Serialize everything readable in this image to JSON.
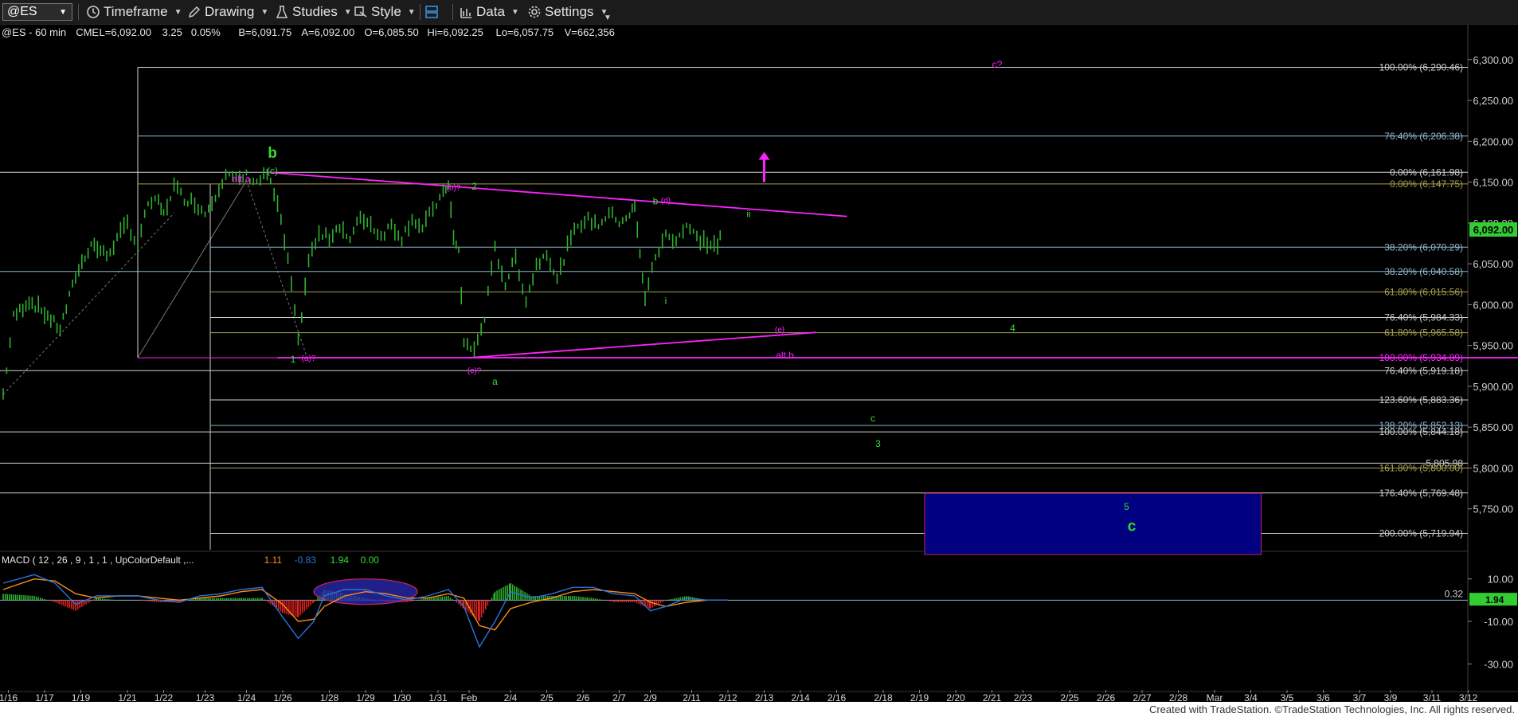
{
  "toolbar": {
    "symbol": "@ES",
    "items": [
      {
        "label": "Timeframe",
        "icon": "clock-icon"
      },
      {
        "label": "Drawing",
        "icon": "pencil-icon"
      },
      {
        "label": "Studies",
        "icon": "flask-icon"
      },
      {
        "label": "Style",
        "icon": "style-icon"
      },
      {
        "label": "Data",
        "icon": "bar-chart-icon"
      },
      {
        "label": "Settings",
        "icon": "gear-icon"
      }
    ]
  },
  "footer": {
    "credit": "Created with TradeStation. ©TradeStation Technologies, Inc. All rights reserved."
  },
  "colors": {
    "candle": "#2fb02f",
    "fib_white": "#cfcfcf",
    "fib_olive": "#a8a050",
    "fib_blue": "#8fb7cc",
    "magenta": "#ff22ff",
    "label_green": "#33dd33",
    "target_box": "#000080",
    "last_price_bg": "#33cc33",
    "macd_line": "#2a73d9",
    "signal_line": "#ff8c1a",
    "hist_up": "#2fb02f",
    "hist_down": "#e02020"
  },
  "chart_data": [
    {
      "type": "line",
      "header": {
        "symbol": "@ES - 60 min",
        "exchange": "CME",
        "last": "L=6,092.00",
        "change": "3.25",
        "change_pct": "0.05%",
        "bid": "B=6,091.75",
        "ask": "A=6,092.00",
        "open": "O=6,085.50",
        "high": "Hi=6,092.25",
        "low": "Lo=6,057.75",
        "volume": "V=662,356"
      },
      "last_price_label": "6,092.00",
      "ylim": [
        5700,
        6330
      ],
      "y_ticks": [
        "6,300.00",
        "6,250.00",
        "6,200.00",
        "6,150.00",
        "6,100.00",
        "6,050.00",
        "6,000.00",
        "5,950.00",
        "5,900.00",
        "5,850.00",
        "5,800.00",
        "5,750.00"
      ],
      "y_tick_values": [
        6300,
        6250,
        6200,
        6150,
        6100,
        6050,
        6000,
        5950,
        5900,
        5850,
        5800,
        5750
      ],
      "x_ticks": [
        "1/16",
        "1/17",
        "1/19",
        "1/21",
        "1/22",
        "1/23",
        "1/24",
        "1/26",
        "1/28",
        "1/29",
        "1/30",
        "1/31",
        "Feb",
        "2/4",
        "2/5",
        "2/6",
        "2/7",
        "2/9",
        "2/11",
        "2/12",
        "2/13",
        "2/14",
        "2/16",
        "2/18",
        "2/19",
        "2/20",
        "2/21",
        "2/23",
        "2/25",
        "2/26",
        "2/27",
        "2/28",
        "Mar",
        "3/4",
        "3/5",
        "3/6",
        "3/7",
        "3/9",
        "3/11",
        "3/12"
      ],
      "x_tick_bars": [
        1,
        8,
        15,
        24,
        31,
        39,
        47,
        54,
        63,
        70,
        77,
        84,
        90,
        98,
        105,
        112,
        119,
        125,
        133,
        140,
        147,
        154,
        161,
        170,
        177,
        184,
        191,
        197,
        206,
        213,
        220,
        227,
        234,
        241,
        248,
        255,
        262,
        268,
        276,
        283
      ],
      "price_path": [
        [
          0,
          5890
        ],
        [
          2,
          5985
        ],
        [
          5,
          6005
        ],
        [
          8,
          5990
        ],
        [
          11,
          5970
        ],
        [
          14,
          6035
        ],
        [
          17,
          6075
        ],
        [
          20,
          6060
        ],
        [
          22,
          6080
        ],
        [
          24,
          6100
        ],
        [
          26,
          6070
        ],
        [
          28,
          6125
        ],
        [
          30,
          6125
        ],
        [
          31,
          6110
        ],
        [
          33,
          6145
        ],
        [
          35,
          6130
        ],
        [
          37,
          6125
        ],
        [
          39,
          6112
        ],
        [
          41,
          6135
        ],
        [
          43,
          6160
        ],
        [
          45,
          6152
        ],
        [
          47,
          6158
        ],
        [
          49,
          6150
        ],
        [
          51,
          6160
        ],
        [
          53,
          6122
        ],
        [
          55,
          6055
        ],
        [
          57,
          5955
        ],
        [
          59,
          6055
        ],
        [
          61,
          6085
        ],
        [
          63,
          6082
        ],
        [
          65,
          6098
        ],
        [
          67,
          6078
        ],
        [
          69,
          6108
        ],
        [
          71,
          6098
        ],
        [
          73,
          6084
        ],
        [
          75,
          6098
        ],
        [
          77,
          6082
        ],
        [
          79,
          6106
        ],
        [
          81,
          6092
        ],
        [
          83,
          6118
        ],
        [
          85,
          6135
        ],
        [
          86,
          6150
        ],
        [
          87,
          6080
        ],
        [
          88,
          6065
        ],
        [
          89,
          5955
        ],
        [
          91,
          5943
        ],
        [
          93,
          5985
        ],
        [
          95,
          6068
        ],
        [
          97,
          6025
        ],
        [
          99,
          6058
        ],
        [
          101,
          6005
        ],
        [
          103,
          6048
        ],
        [
          105,
          6065
        ],
        [
          107,
          6030
        ],
        [
          109,
          6070
        ],
        [
          111,
          6098
        ],
        [
          113,
          6104
        ],
        [
          115,
          6098
        ],
        [
          117,
          6112
        ],
        [
          119,
          6102
        ],
        [
          121,
          6110
        ],
        [
          122,
          6120
        ],
        [
          123,
          6060
        ],
        [
          124,
          6010
        ],
        [
          126,
          6058
        ],
        [
          128,
          6085
        ],
        [
          130,
          6080
        ],
        [
          132,
          6097
        ],
        [
          134,
          6082
        ],
        [
          136,
          6075
        ],
        [
          138,
          6072
        ],
        [
          139,
          6092
        ]
      ],
      "fib_levels": [
        {
          "label": "100.00% (6,290.46)",
          "value": 6290.46,
          "color": "white"
        },
        {
          "label": "76.40% (6,206.38)",
          "value": 6206.38,
          "color": "blue"
        },
        {
          "label": "0.00% (6,161.98)",
          "value": 6161.98,
          "color": "white"
        },
        {
          "label": "0.00% (6,147.75)",
          "value": 6147.75,
          "color": "olive"
        },
        {
          "label": "38.20% (6,070.29)",
          "value": 6070.29,
          "color": "blue"
        },
        {
          "label": "38.20% (6,040.58)",
          "value": 6040.58,
          "color": "blue"
        },
        {
          "label": "61.80% (6,015.56)",
          "value": 6015.56,
          "color": "olive"
        },
        {
          "label": "76.40% (5,984.33)",
          "value": 5984.33,
          "color": "white"
        },
        {
          "label": "61.80% (5,965.58)",
          "value": 5965.58,
          "color": "olive"
        },
        {
          "label": "100.00% (5,934.89)",
          "value": 5934.89,
          "color": "magenta"
        },
        {
          "label": "76.40% (5,919.18)",
          "value": 5919.18,
          "color": "white"
        },
        {
          "label": "123.60% (5,883.36)",
          "value": 5883.36,
          "color": "white"
        },
        {
          "label": "138.20% (5,852.13)",
          "value": 5852.13,
          "color": "blue"
        },
        {
          "label": "100.00% (5,844.18)",
          "value": 5844.18,
          "color": "white"
        },
        {
          "label": "5,805.98",
          "value": 5805.98,
          "color": "white"
        },
        {
          "label": "161.80% (5,800.00)",
          "value": 5800.0,
          "color": "olive"
        },
        {
          "label": "176.40% (5,769.48)",
          "value": 5769.48,
          "color": "white"
        },
        {
          "label": "200.00% (5,719.94)",
          "value": 5719.94,
          "color": "white"
        }
      ],
      "trendlines": [
        {
          "from": [
            51,
            6162
          ],
          "to": [
            163,
            6108
          ],
          "color": "magenta"
        },
        {
          "from": [
            90,
            5935
          ],
          "to": [
            157,
            5966
          ],
          "color": "magenta"
        },
        {
          "from": [
            53,
            5935
          ],
          "to": [
            298,
            5935
          ],
          "color": "magenta"
        }
      ],
      "target_box": {
        "x_from": 178,
        "x_to": 243,
        "y_from": 5694,
        "y_to": 5769
      },
      "annotations": [
        {
          "text": "b",
          "x": 52,
          "y": 6180,
          "color": "green",
          "size": "large",
          "bold": true
        },
        {
          "text": "(c)",
          "x": 52,
          "y": 6160,
          "color": "green",
          "size": "small"
        },
        {
          "text": "alt a",
          "x": 46,
          "y": 6150,
          "color": "magenta",
          "size": "small"
        },
        {
          "text": "(b)?",
          "x": 87,
          "y": 6140,
          "color": "magenta",
          "size": "tiny"
        },
        {
          "text": "2",
          "x": 91,
          "y": 6141,
          "color": "green",
          "size": "small"
        },
        {
          "text": "b",
          "x": 126,
          "y": 6123,
          "color": "green",
          "size": "small"
        },
        {
          "text": "(d)",
          "x": 128,
          "y": 6124,
          "color": "magenta",
          "size": "tiny"
        },
        {
          "text": "ii",
          "x": 144,
          "y": 6107,
          "color": "green",
          "size": "small"
        },
        {
          "text": "i",
          "x": 128,
          "y": 6001,
          "color": "green",
          "size": "small"
        },
        {
          "text": "(e)",
          "x": 150,
          "y": 5966,
          "color": "magenta",
          "size": "tiny"
        },
        {
          "text": "alt b",
          "x": 151,
          "y": 5934,
          "color": "magenta",
          "size": "small"
        },
        {
          "text": "1",
          "x": 56,
          "y": 5929,
          "color": "green",
          "size": "small"
        },
        {
          "text": "(a)?",
          "x": 59,
          "y": 5931,
          "color": "magenta",
          "size": "tiny"
        },
        {
          "text": "(c)?",
          "x": 91,
          "y": 5916,
          "color": "magenta",
          "size": "tiny"
        },
        {
          "text": "a",
          "x": 95,
          "y": 5902,
          "color": "green",
          "size": "small"
        },
        {
          "text": "c?",
          "x": 192,
          "y": 6290,
          "color": "magenta",
          "size": "small"
        },
        {
          "text": "4",
          "x": 195,
          "y": 5967,
          "color": "green",
          "size": "small"
        },
        {
          "text": "c",
          "x": 168,
          "y": 5857,
          "color": "green",
          "size": "small"
        },
        {
          "text": "3",
          "x": 169,
          "y": 5826,
          "color": "green",
          "size": "small"
        },
        {
          "text": "5",
          "x": 217,
          "y": 5749,
          "color": "green",
          "size": "small"
        },
        {
          "text": "c",
          "x": 218,
          "y": 5723,
          "color": "green",
          "size": "large",
          "bold": true
        }
      ],
      "arrow_up": {
        "x": 147,
        "y_from": 6150,
        "y_to": 6185
      }
    },
    {
      "type": "line",
      "title": "MACD ( 12 , 26 , 9 , 1 , 1 , UpColorDefault ,...",
      "readouts": [
        "1.11",
        "-0.83",
        "1.94",
        "0.00"
      ],
      "ylim": [
        -40,
        20
      ],
      "y_ticks": [
        "10.00",
        "-10.00",
        "-30.00"
      ],
      "y_tick_values": [
        10,
        -10,
        -30
      ],
      "last_value_label": "1.94",
      "ref_label": "0.32",
      "macd": [
        [
          0,
          8
        ],
        [
          6,
          12
        ],
        [
          10,
          8
        ],
        [
          14,
          -2
        ],
        [
          18,
          2
        ],
        [
          22,
          2
        ],
        [
          26,
          2
        ],
        [
          30,
          0
        ],
        [
          34,
          -1
        ],
        [
          38,
          2
        ],
        [
          42,
          3
        ],
        [
          46,
          5
        ],
        [
          50,
          6
        ],
        [
          54,
          -8
        ],
        [
          57,
          -18
        ],
        [
          60,
          -10
        ],
        [
          62,
          2
        ],
        [
          66,
          5
        ],
        [
          70,
          5
        ],
        [
          74,
          2
        ],
        [
          78,
          0
        ],
        [
          82,
          2
        ],
        [
          86,
          5
        ],
        [
          89,
          -3
        ],
        [
          92,
          -22
        ],
        [
          95,
          -10
        ],
        [
          98,
          4
        ],
        [
          102,
          1
        ],
        [
          106,
          3
        ],
        [
          110,
          6
        ],
        [
          114,
          6
        ],
        [
          118,
          3
        ],
        [
          122,
          2
        ],
        [
          125,
          -5
        ],
        [
          128,
          -3
        ],
        [
          132,
          1
        ],
        [
          136,
          0
        ],
        [
          140,
          0
        ]
      ],
      "signal": [
        [
          0,
          5
        ],
        [
          6,
          10
        ],
        [
          10,
          9
        ],
        [
          14,
          3
        ],
        [
          18,
          1
        ],
        [
          22,
          2
        ],
        [
          26,
          2
        ],
        [
          30,
          1
        ],
        [
          34,
          0
        ],
        [
          38,
          1
        ],
        [
          42,
          2
        ],
        [
          46,
          4
        ],
        [
          50,
          5
        ],
        [
          54,
          -2
        ],
        [
          57,
          -10
        ],
        [
          60,
          -9
        ],
        [
          62,
          -3
        ],
        [
          66,
          2
        ],
        [
          70,
          4
        ],
        [
          74,
          3
        ],
        [
          78,
          1
        ],
        [
          82,
          1
        ],
        [
          86,
          3
        ],
        [
          89,
          1
        ],
        [
          92,
          -12
        ],
        [
          95,
          -14
        ],
        [
          98,
          -4
        ],
        [
          102,
          -1
        ],
        [
          106,
          1
        ],
        [
          110,
          4
        ],
        [
          114,
          5
        ],
        [
          118,
          4
        ],
        [
          122,
          3
        ],
        [
          125,
          -1
        ],
        [
          128,
          -3
        ],
        [
          132,
          -1
        ],
        [
          136,
          0
        ],
        [
          140,
          0
        ]
      ],
      "histogram_points": [
        [
          0,
          3
        ],
        [
          6,
          2
        ],
        [
          10,
          -1
        ],
        [
          14,
          -5
        ],
        [
          18,
          1
        ],
        [
          22,
          0
        ],
        [
          26,
          0
        ],
        [
          30,
          -1
        ],
        [
          34,
          -1
        ],
        [
          38,
          1
        ],
        [
          42,
          1
        ],
        [
          46,
          1
        ],
        [
          50,
          1
        ],
        [
          54,
          -6
        ],
        [
          57,
          -8
        ],
        [
          60,
          -1
        ],
        [
          62,
          5
        ],
        [
          66,
          3
        ],
        [
          70,
          1
        ],
        [
          74,
          -1
        ],
        [
          78,
          -1
        ],
        [
          82,
          1
        ],
        [
          86,
          2
        ],
        [
          89,
          -4
        ],
        [
          92,
          -10
        ],
        [
          95,
          4
        ],
        [
          98,
          8
        ],
        [
          102,
          2
        ],
        [
          106,
          2
        ],
        [
          110,
          2
        ],
        [
          114,
          1
        ],
        [
          118,
          -1
        ],
        [
          122,
          -1
        ],
        [
          125,
          -4
        ],
        [
          128,
          0
        ],
        [
          132,
          2
        ],
        [
          136,
          0
        ],
        [
          140,
          0
        ]
      ],
      "highlight_ellipse": {
        "x_from": 60,
        "x_to": 80,
        "y_from": -2,
        "y_to": 10
      }
    }
  ]
}
